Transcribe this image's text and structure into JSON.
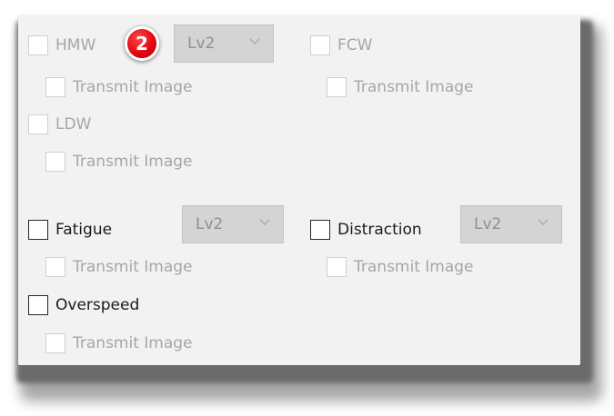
{
  "badge": {
    "number": "2",
    "color": "#e30613"
  },
  "hmw": {
    "label": "HMW",
    "level": "Lv2",
    "transmit_label": "Transmit Image"
  },
  "fcw": {
    "label": "FCW",
    "transmit_label": "Transmit Image"
  },
  "ldw": {
    "label": "LDW",
    "transmit_label": "Transmit Image"
  },
  "fatigue": {
    "label": "Fatigue",
    "level": "Lv2",
    "transmit_label": "Transmit Image"
  },
  "distraction": {
    "label": "Distraction",
    "level": "Lv2",
    "transmit_label": "Transmit Image"
  },
  "overspeed": {
    "label": "Overspeed",
    "transmit_label": "Transmit Image"
  },
  "icons": {
    "dropdown": "chevron-down-icon",
    "callout": "step-number-badge"
  },
  "colors": {
    "panel_bg": "#f2f2f2",
    "disabled_text": "#a6a6a6",
    "enabled_text": "#1a1a1a",
    "select_bg": "#d4d4d4"
  }
}
